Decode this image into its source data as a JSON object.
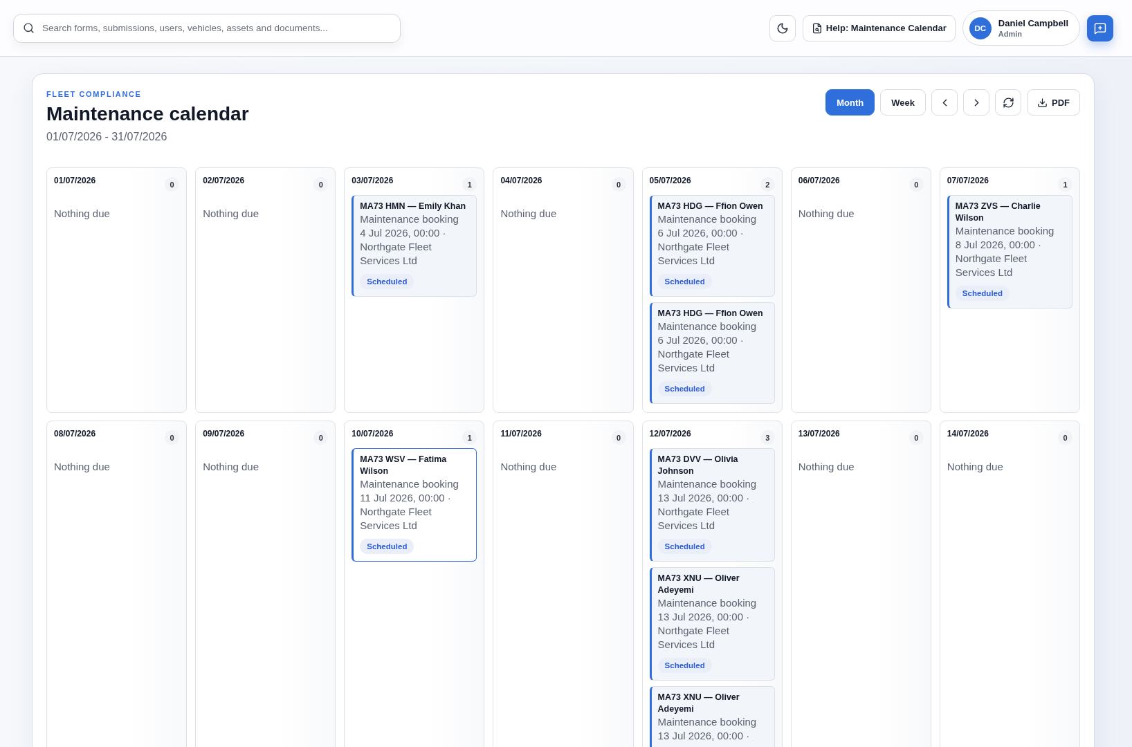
{
  "search": {
    "placeholder": "Search forms, submissions, users, vehicles, assets and documents..."
  },
  "help_button": {
    "label": "Help: Maintenance Calendar"
  },
  "user": {
    "initials": "DC",
    "name": "Daniel Campbell",
    "role": "Admin"
  },
  "page": {
    "eyebrow": "FLEET COMPLIANCE",
    "title": "Maintenance calendar",
    "date_range": "01/07/2026 - 31/07/2026"
  },
  "view_tabs": [
    {
      "label": "Month",
      "selected": true
    },
    {
      "label": "Week",
      "selected": false
    }
  ],
  "pdf_button": {
    "label": "PDF"
  },
  "calendar": {
    "days": [
      {
        "date": "01/07/2026",
        "count": "0",
        "empty_text": "Nothing due"
      },
      {
        "date": "02/07/2026",
        "count": "0",
        "empty_text": "Nothing due"
      },
      {
        "date": "03/07/2026",
        "count": "1",
        "events": [
          {
            "title": "MA73 HMN — Emily Khan",
            "type": "Maintenance booking",
            "details": "4 Jul 2026, 00:00 · Northgate Fleet Services Ltd",
            "status": "Scheduled",
            "selected": false
          }
        ]
      },
      {
        "date": "04/07/2026",
        "count": "0",
        "empty_text": "Nothing due"
      },
      {
        "date": "05/07/2026",
        "count": "2",
        "events": [
          {
            "title": "MA73 HDG — Ffion Owen",
            "type": "Maintenance booking",
            "details": "6 Jul 2026, 00:00 · Northgate Fleet Services Ltd",
            "status": "Scheduled",
            "selected": false
          },
          {
            "title": "MA73 HDG — Ffion Owen",
            "type": "Maintenance booking",
            "details": "6 Jul 2026, 00:00 · Northgate Fleet Services Ltd",
            "status": "Scheduled",
            "selected": false
          }
        ]
      },
      {
        "date": "06/07/2026",
        "count": "0",
        "empty_text": "Nothing due"
      },
      {
        "date": "07/07/2026",
        "count": "1",
        "events": [
          {
            "title": "MA73 ZVS — Charlie Wilson",
            "type": "Maintenance booking",
            "details": "8 Jul 2026, 00:00 · Northgate Fleet Services Ltd",
            "status": "Scheduled",
            "selected": false
          }
        ]
      },
      {
        "date": "08/07/2026",
        "count": "0",
        "empty_text": "Nothing due"
      },
      {
        "date": "09/07/2026",
        "count": "0",
        "empty_text": "Nothing due"
      },
      {
        "date": "10/07/2026",
        "count": "1",
        "events": [
          {
            "title": "MA73 WSV — Fatima Wilson",
            "type": "Maintenance booking",
            "details": "11 Jul 2026, 00:00 · Northgate Fleet Services Ltd",
            "status": "Scheduled",
            "selected": true
          }
        ]
      },
      {
        "date": "11/07/2026",
        "count": "0",
        "empty_text": "Nothing due"
      },
      {
        "date": "12/07/2026",
        "count": "3",
        "events": [
          {
            "title": "MA73 DVV — Olivia Johnson",
            "type": "Maintenance booking",
            "details": "13 Jul 2026, 00:00 · Northgate Fleet Services Ltd",
            "status": "Scheduled",
            "selected": false
          },
          {
            "title": "MA73 XNU — Oliver Adeyemi",
            "type": "Maintenance booking",
            "details": "13 Jul 2026, 00:00 · Northgate Fleet Services Ltd",
            "status": "Scheduled",
            "selected": false
          },
          {
            "title": "MA73 XNU — Oliver Adeyemi",
            "type": "Maintenance booking",
            "details": "13 Jul 2026, 00:00 ·",
            "selected": false
          }
        ]
      },
      {
        "date": "13/07/2026",
        "count": "0",
        "empty_text": "Nothing due"
      },
      {
        "date": "14/07/2026",
        "count": "0",
        "empty_text": "Nothing due"
      }
    ]
  }
}
